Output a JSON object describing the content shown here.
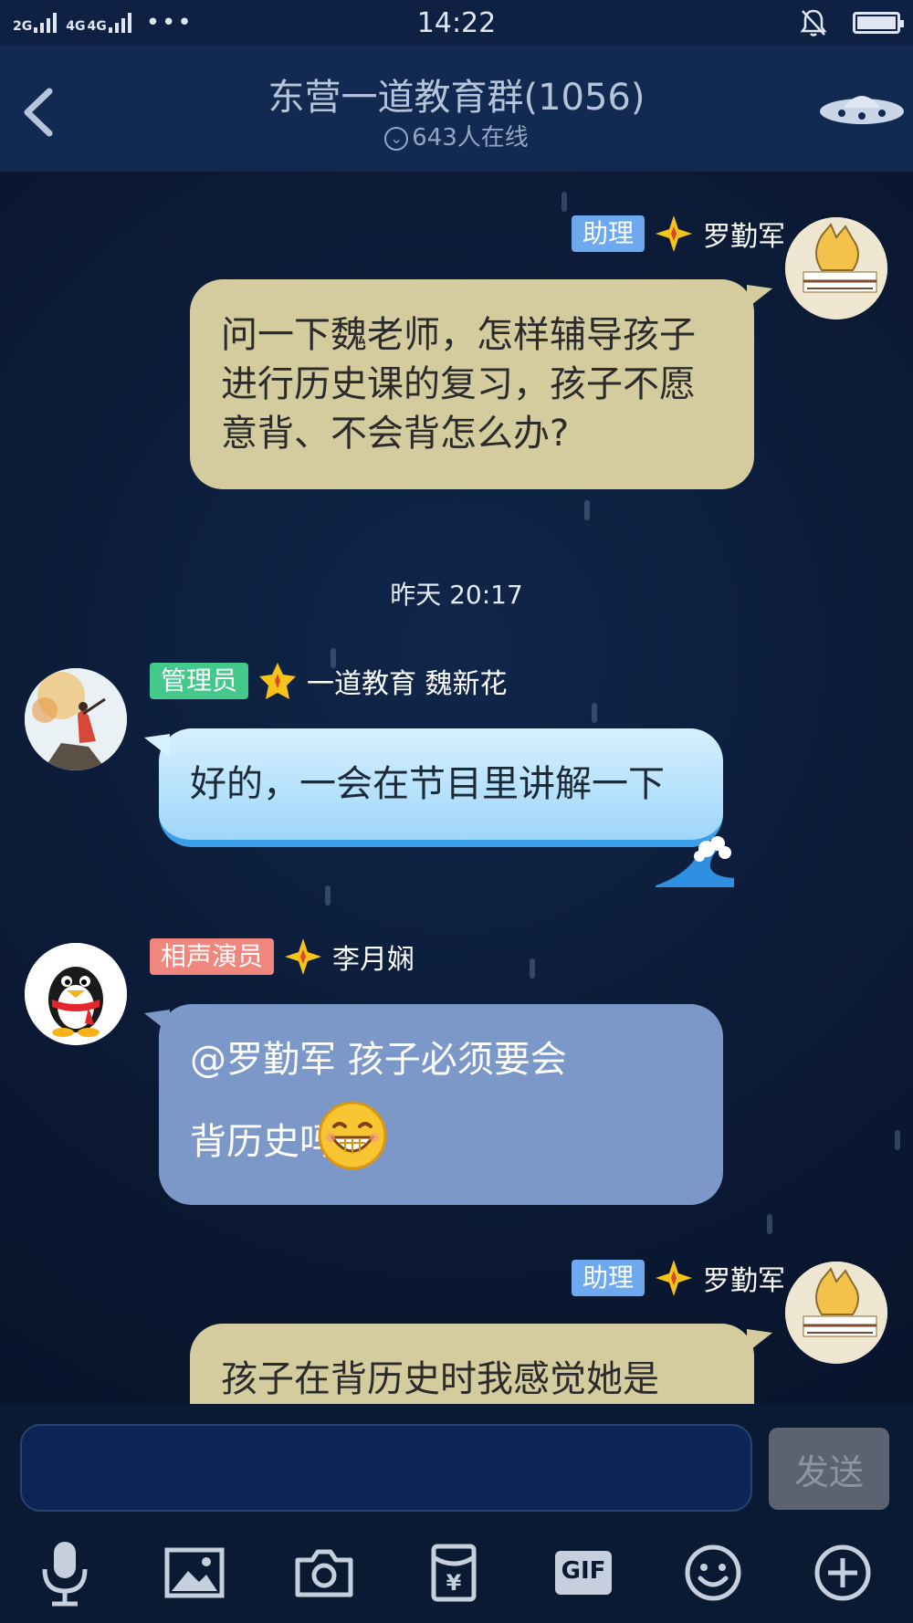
{
  "status_bar": {
    "network_1": "2G",
    "network_2": "4G",
    "network_3": "4G",
    "more": "•••",
    "time": "14:22",
    "icons": [
      "signal-icon",
      "bell-off-icon",
      "battery-icon"
    ]
  },
  "header": {
    "title": "东营一道教育群(1056)",
    "online": "643人在线",
    "icons": [
      "back-icon",
      "chevron-down-icon",
      "ufo-icon"
    ]
  },
  "messages": [
    {
      "side": "right",
      "badge": "助理",
      "sender": "罗勤军",
      "text": "问一下魏老师，怎样辅导孩子进行历史课的复习，孩子不愿意背、不会背怎么办?"
    },
    {
      "timestamp": "昨天 20:17"
    },
    {
      "side": "left",
      "badge": "管理员",
      "sender": "一道教育 魏新花",
      "text": "好的，一会在节目里讲解一下"
    },
    {
      "side": "left",
      "badge": "相声演员",
      "sender": "李月娴",
      "text": "@罗勤军 孩子必须要会背历史吗？",
      "emoji": "grinning-face-icon"
    },
    {
      "side": "right",
      "badge": "助理",
      "sender": "罗勤军",
      "text": "孩子在背历史时我感觉她是"
    }
  ],
  "composer": {
    "input_value": "",
    "send_label": "发送",
    "tools": [
      "microphone-icon",
      "image-icon",
      "camera-icon",
      "red-packet-icon",
      "gif-icon",
      "emoji-icon",
      "plus-icon"
    ],
    "gif_label": "GIF"
  },
  "colors": {
    "background": "#0b1a33",
    "header": "#122a52",
    "bubble_tan": "#d4cb9f",
    "bubble_sky": "#bfe6fd",
    "bubble_steel": "#7b98c8",
    "badge_assistant": "#6ea8ef",
    "badge_admin": "#45c98b",
    "badge_performer": "#f0877f"
  }
}
